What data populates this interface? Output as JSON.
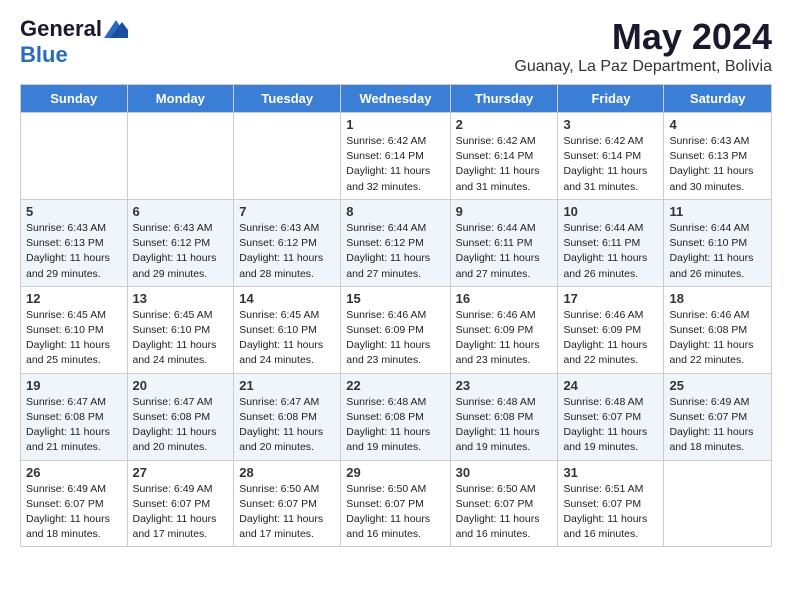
{
  "logo": {
    "general": "General",
    "blue": "Blue"
  },
  "header": {
    "month": "May 2024",
    "location": "Guanay, La Paz Department, Bolivia"
  },
  "days_of_week": [
    "Sunday",
    "Monday",
    "Tuesday",
    "Wednesday",
    "Thursday",
    "Friday",
    "Saturday"
  ],
  "weeks": [
    [
      {
        "day": "",
        "info": ""
      },
      {
        "day": "",
        "info": ""
      },
      {
        "day": "",
        "info": ""
      },
      {
        "day": "1",
        "info": "Sunrise: 6:42 AM\nSunset: 6:14 PM\nDaylight: 11 hours and 32 minutes."
      },
      {
        "day": "2",
        "info": "Sunrise: 6:42 AM\nSunset: 6:14 PM\nDaylight: 11 hours and 31 minutes."
      },
      {
        "day": "3",
        "info": "Sunrise: 6:42 AM\nSunset: 6:14 PM\nDaylight: 11 hours and 31 minutes."
      },
      {
        "day": "4",
        "info": "Sunrise: 6:43 AM\nSunset: 6:13 PM\nDaylight: 11 hours and 30 minutes."
      }
    ],
    [
      {
        "day": "5",
        "info": "Sunrise: 6:43 AM\nSunset: 6:13 PM\nDaylight: 11 hours and 29 minutes."
      },
      {
        "day": "6",
        "info": "Sunrise: 6:43 AM\nSunset: 6:12 PM\nDaylight: 11 hours and 29 minutes."
      },
      {
        "day": "7",
        "info": "Sunrise: 6:43 AM\nSunset: 6:12 PM\nDaylight: 11 hours and 28 minutes."
      },
      {
        "day": "8",
        "info": "Sunrise: 6:44 AM\nSunset: 6:12 PM\nDaylight: 11 hours and 27 minutes."
      },
      {
        "day": "9",
        "info": "Sunrise: 6:44 AM\nSunset: 6:11 PM\nDaylight: 11 hours and 27 minutes."
      },
      {
        "day": "10",
        "info": "Sunrise: 6:44 AM\nSunset: 6:11 PM\nDaylight: 11 hours and 26 minutes."
      },
      {
        "day": "11",
        "info": "Sunrise: 6:44 AM\nSunset: 6:10 PM\nDaylight: 11 hours and 26 minutes."
      }
    ],
    [
      {
        "day": "12",
        "info": "Sunrise: 6:45 AM\nSunset: 6:10 PM\nDaylight: 11 hours and 25 minutes."
      },
      {
        "day": "13",
        "info": "Sunrise: 6:45 AM\nSunset: 6:10 PM\nDaylight: 11 hours and 24 minutes."
      },
      {
        "day": "14",
        "info": "Sunrise: 6:45 AM\nSunset: 6:10 PM\nDaylight: 11 hours and 24 minutes."
      },
      {
        "day": "15",
        "info": "Sunrise: 6:46 AM\nSunset: 6:09 PM\nDaylight: 11 hours and 23 minutes."
      },
      {
        "day": "16",
        "info": "Sunrise: 6:46 AM\nSunset: 6:09 PM\nDaylight: 11 hours and 23 minutes."
      },
      {
        "day": "17",
        "info": "Sunrise: 6:46 AM\nSunset: 6:09 PM\nDaylight: 11 hours and 22 minutes."
      },
      {
        "day": "18",
        "info": "Sunrise: 6:46 AM\nSunset: 6:08 PM\nDaylight: 11 hours and 22 minutes."
      }
    ],
    [
      {
        "day": "19",
        "info": "Sunrise: 6:47 AM\nSunset: 6:08 PM\nDaylight: 11 hours and 21 minutes."
      },
      {
        "day": "20",
        "info": "Sunrise: 6:47 AM\nSunset: 6:08 PM\nDaylight: 11 hours and 20 minutes."
      },
      {
        "day": "21",
        "info": "Sunrise: 6:47 AM\nSunset: 6:08 PM\nDaylight: 11 hours and 20 minutes."
      },
      {
        "day": "22",
        "info": "Sunrise: 6:48 AM\nSunset: 6:08 PM\nDaylight: 11 hours and 19 minutes."
      },
      {
        "day": "23",
        "info": "Sunrise: 6:48 AM\nSunset: 6:08 PM\nDaylight: 11 hours and 19 minutes."
      },
      {
        "day": "24",
        "info": "Sunrise: 6:48 AM\nSunset: 6:07 PM\nDaylight: 11 hours and 19 minutes."
      },
      {
        "day": "25",
        "info": "Sunrise: 6:49 AM\nSunset: 6:07 PM\nDaylight: 11 hours and 18 minutes."
      }
    ],
    [
      {
        "day": "26",
        "info": "Sunrise: 6:49 AM\nSunset: 6:07 PM\nDaylight: 11 hours and 18 minutes."
      },
      {
        "day": "27",
        "info": "Sunrise: 6:49 AM\nSunset: 6:07 PM\nDaylight: 11 hours and 17 minutes."
      },
      {
        "day": "28",
        "info": "Sunrise: 6:50 AM\nSunset: 6:07 PM\nDaylight: 11 hours and 17 minutes."
      },
      {
        "day": "29",
        "info": "Sunrise: 6:50 AM\nSunset: 6:07 PM\nDaylight: 11 hours and 16 minutes."
      },
      {
        "day": "30",
        "info": "Sunrise: 6:50 AM\nSunset: 6:07 PM\nDaylight: 11 hours and 16 minutes."
      },
      {
        "day": "31",
        "info": "Sunrise: 6:51 AM\nSunset: 6:07 PM\nDaylight: 11 hours and 16 minutes."
      },
      {
        "day": "",
        "info": ""
      }
    ]
  ]
}
